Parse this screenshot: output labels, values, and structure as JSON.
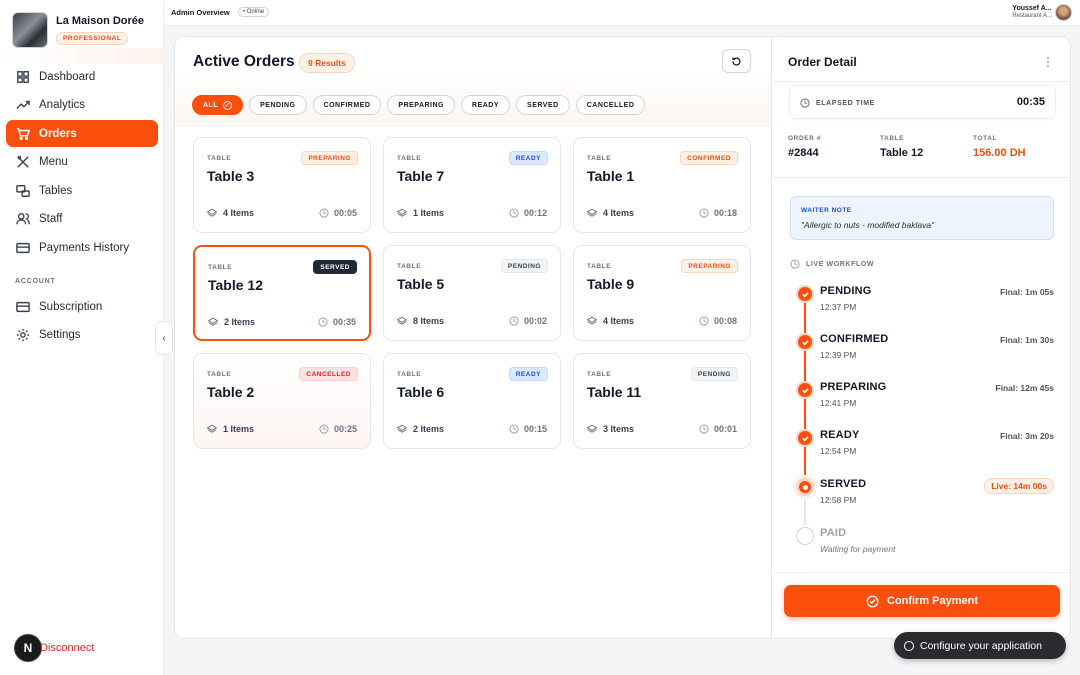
{
  "brand": {
    "name": "La Maison Dorée",
    "badge": "PROFESSIONAL"
  },
  "topbar": {
    "title": "Admin Overview",
    "status": "• Online",
    "user_name": "Youssef A...",
    "user_role": "Restaurant A..."
  },
  "nav": {
    "items": [
      {
        "label": "Dashboard",
        "icon": "grid-icon"
      },
      {
        "label": "Analytics",
        "icon": "trend-icon"
      },
      {
        "label": "Orders",
        "icon": "cart-icon",
        "active": true
      },
      {
        "label": "Menu",
        "icon": "utensils-icon"
      },
      {
        "label": "Tables",
        "icon": "tables-icon"
      },
      {
        "label": "Staff",
        "icon": "users-icon"
      },
      {
        "label": "Payments History",
        "icon": "card-icon"
      }
    ],
    "account_label": "ACCOUNT",
    "account_items": [
      {
        "label": "Subscription",
        "icon": "card-icon"
      },
      {
        "label": "Settings",
        "icon": "gear-icon"
      }
    ],
    "disconnect": "Disconnect",
    "n_logo": "N"
  },
  "orders": {
    "title": "Active Orders",
    "results": "9 Results",
    "filters": [
      "ALL",
      "PENDING",
      "CONFIRMED",
      "PREPARING",
      "READY",
      "SERVED",
      "CANCELLED"
    ],
    "cards": [
      {
        "label": "TABLE",
        "name": "Table 3",
        "status": "PREPARING",
        "items": "4 Items",
        "time": "00:05"
      },
      {
        "label": "TABLE",
        "name": "Table 7",
        "status": "READY",
        "items": "1 Items",
        "time": "00:12"
      },
      {
        "label": "TABLE",
        "name": "Table 1",
        "status": "CONFIRMED",
        "items": "4 Items",
        "time": "00:18"
      },
      {
        "label": "TABLE",
        "name": "Table 12",
        "status": "SERVED",
        "items": "2 Items",
        "time": "00:35"
      },
      {
        "label": "TABLE",
        "name": "Table 5",
        "status": "PENDING",
        "items": "8 Items",
        "time": "00:02"
      },
      {
        "label": "TABLE",
        "name": "Table 9",
        "status": "PREPARING",
        "items": "4 Items",
        "time": "00:08"
      },
      {
        "label": "TABLE",
        "name": "Table 2",
        "status": "CANCELLED",
        "items": "1 Items",
        "time": "00:25"
      },
      {
        "label": "TABLE",
        "name": "Table 6",
        "status": "READY",
        "items": "2 Items",
        "time": "00:15"
      },
      {
        "label": "TABLE",
        "name": "Table 11",
        "status": "PENDING",
        "items": "3 Items",
        "time": "00:01"
      }
    ]
  },
  "detail": {
    "title": "Order Detail",
    "elapsed_label": "ELAPSED TIME",
    "elapsed_value": "00:35",
    "order_label": "ORDER #",
    "order_value": "#2844",
    "table_label": "TABLE",
    "table_value": "Table 12",
    "total_label": "TOTAL",
    "total_value": "156.00 DH",
    "note_label": "WAITER NOTE",
    "note_text": "\"Allergic to nuts - modified baklava\"",
    "workflow_label": "LIVE WORKFLOW",
    "steps": [
      {
        "name": "PENDING",
        "time": "12:37 PM",
        "duration": "Final: 1m 05s",
        "state": "done"
      },
      {
        "name": "CONFIRMED",
        "time": "12:39 PM",
        "duration": "Final: 1m 30s",
        "state": "done"
      },
      {
        "name": "PREPARING",
        "time": "12:41 PM",
        "duration": "Final: 12m 45s",
        "state": "done"
      },
      {
        "name": "READY",
        "time": "12:54 PM",
        "duration": "Final: 3m 20s",
        "state": "done"
      },
      {
        "name": "SERVED",
        "time": "12:58 PM",
        "duration": "Live: 14m 00s",
        "state": "live"
      },
      {
        "name": "PAID",
        "time": "Waiting for payment",
        "duration": "",
        "state": "todo"
      }
    ],
    "confirm_button": "Confirm Payment"
  },
  "config_toast": "Configure your application",
  "colors": {
    "accent": "#fb4f0e",
    "ready": "#1d4ed8",
    "served": "#1f2937",
    "cancelled": "#dc2626"
  }
}
